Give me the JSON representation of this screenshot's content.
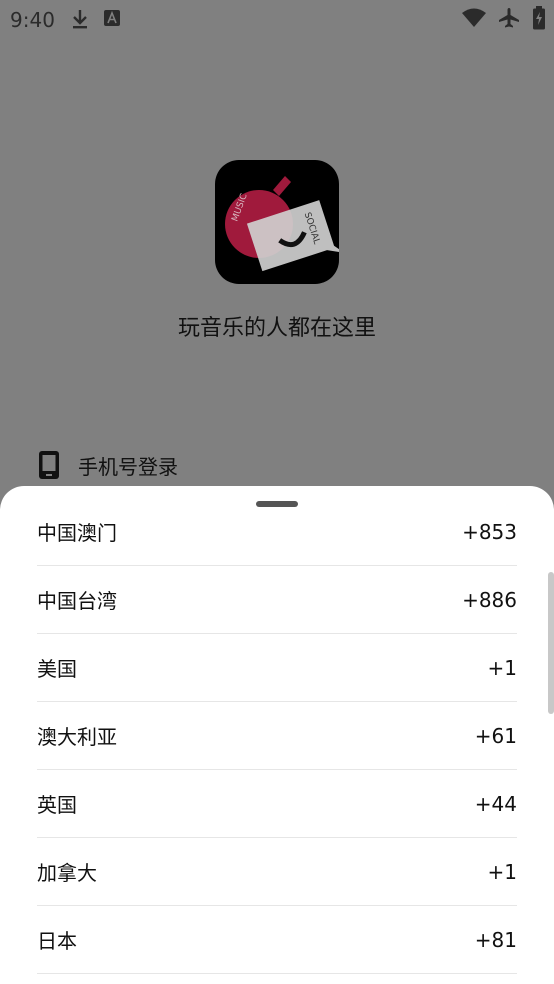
{
  "status_bar": {
    "time": "9:40",
    "icons": [
      "download-icon",
      "a-icon",
      "wifi-icon",
      "airplane-icon",
      "battery-icon"
    ]
  },
  "app": {
    "icon_text_1": "MUSIC",
    "icon_text_2": "SOCIAL",
    "slogan": "玩音乐的人都在这里",
    "phone_login_label": "手机号登录"
  },
  "country_list": [
    {
      "name": "中国澳门",
      "code": "+853"
    },
    {
      "name": "中国台湾",
      "code": "+886"
    },
    {
      "name": "美国",
      "code": "+1"
    },
    {
      "name": "澳大利亚",
      "code": "+61"
    },
    {
      "name": "英国",
      "code": "+44"
    },
    {
      "name": "加拿大",
      "code": "+1"
    },
    {
      "name": "日本",
      "code": "+81"
    }
  ],
  "colors": {
    "overlay": "#808080",
    "sheet_bg": "#ffffff",
    "accent": "#a01a3c"
  }
}
